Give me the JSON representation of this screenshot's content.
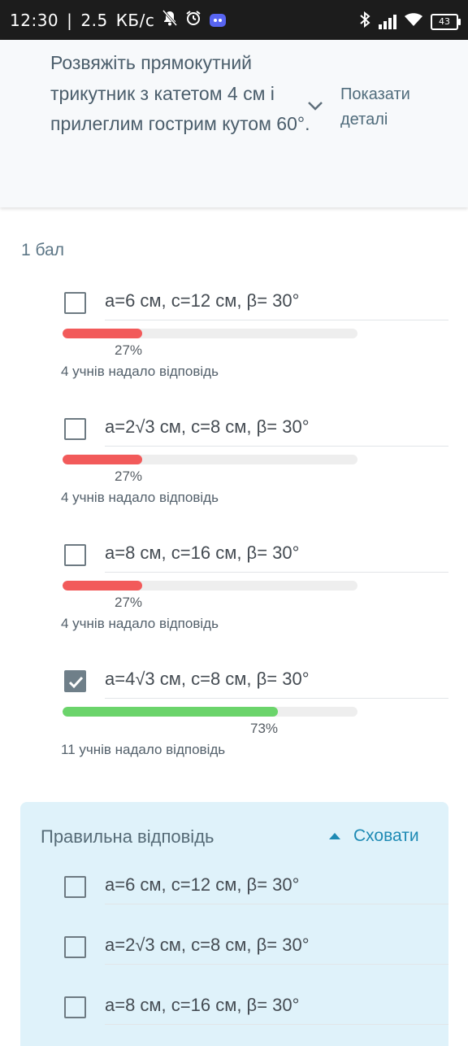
{
  "status_bar": {
    "time": "12:30",
    "net_speed": "2.5",
    "net_unit": "КБ/с",
    "battery": "43"
  },
  "question": {
    "text": "Розвяжіть прямокутний трикутник з катетом 4 см і прилеглим гострим кутом 60°.",
    "details_label": "Показати деталі"
  },
  "points_label": "1 бал",
  "options": [
    {
      "label": "a=6 см, c=12 см, β= 30°",
      "percent_label": "27%",
      "fraction": 0.27,
      "count_label": "4 учнів надало відповідь",
      "checked": false,
      "bar_color": "#f25a5a"
    },
    {
      "label": "a=2√3 см, c=8 см, β= 30°",
      "percent_label": "27%",
      "fraction": 0.27,
      "count_label": "4 учнів надало відповідь",
      "checked": false,
      "bar_color": "#f25a5a"
    },
    {
      "label": "a=8 см, c=16 см, β= 30°",
      "percent_label": "27%",
      "fraction": 0.27,
      "count_label": "4 учнів надало відповідь",
      "checked": false,
      "bar_color": "#f25a5a"
    },
    {
      "label": "a=4√3 см, c=8 см, β= 30°",
      "percent_label": "73%",
      "fraction": 0.73,
      "count_label": "11 учнів надало відповідь",
      "checked": true,
      "bar_color": "#6bd46b"
    }
  ],
  "correct_answer": {
    "title": "Правильна відповідь",
    "hide_label": "Сховати",
    "options": [
      {
        "label": "a=6 см, c=12 см, β= 30°"
      },
      {
        "label": "a=2√3 см, c=8 см, β= 30°"
      },
      {
        "label": "a=8 см, c=16 см, β= 30°"
      }
    ]
  }
}
